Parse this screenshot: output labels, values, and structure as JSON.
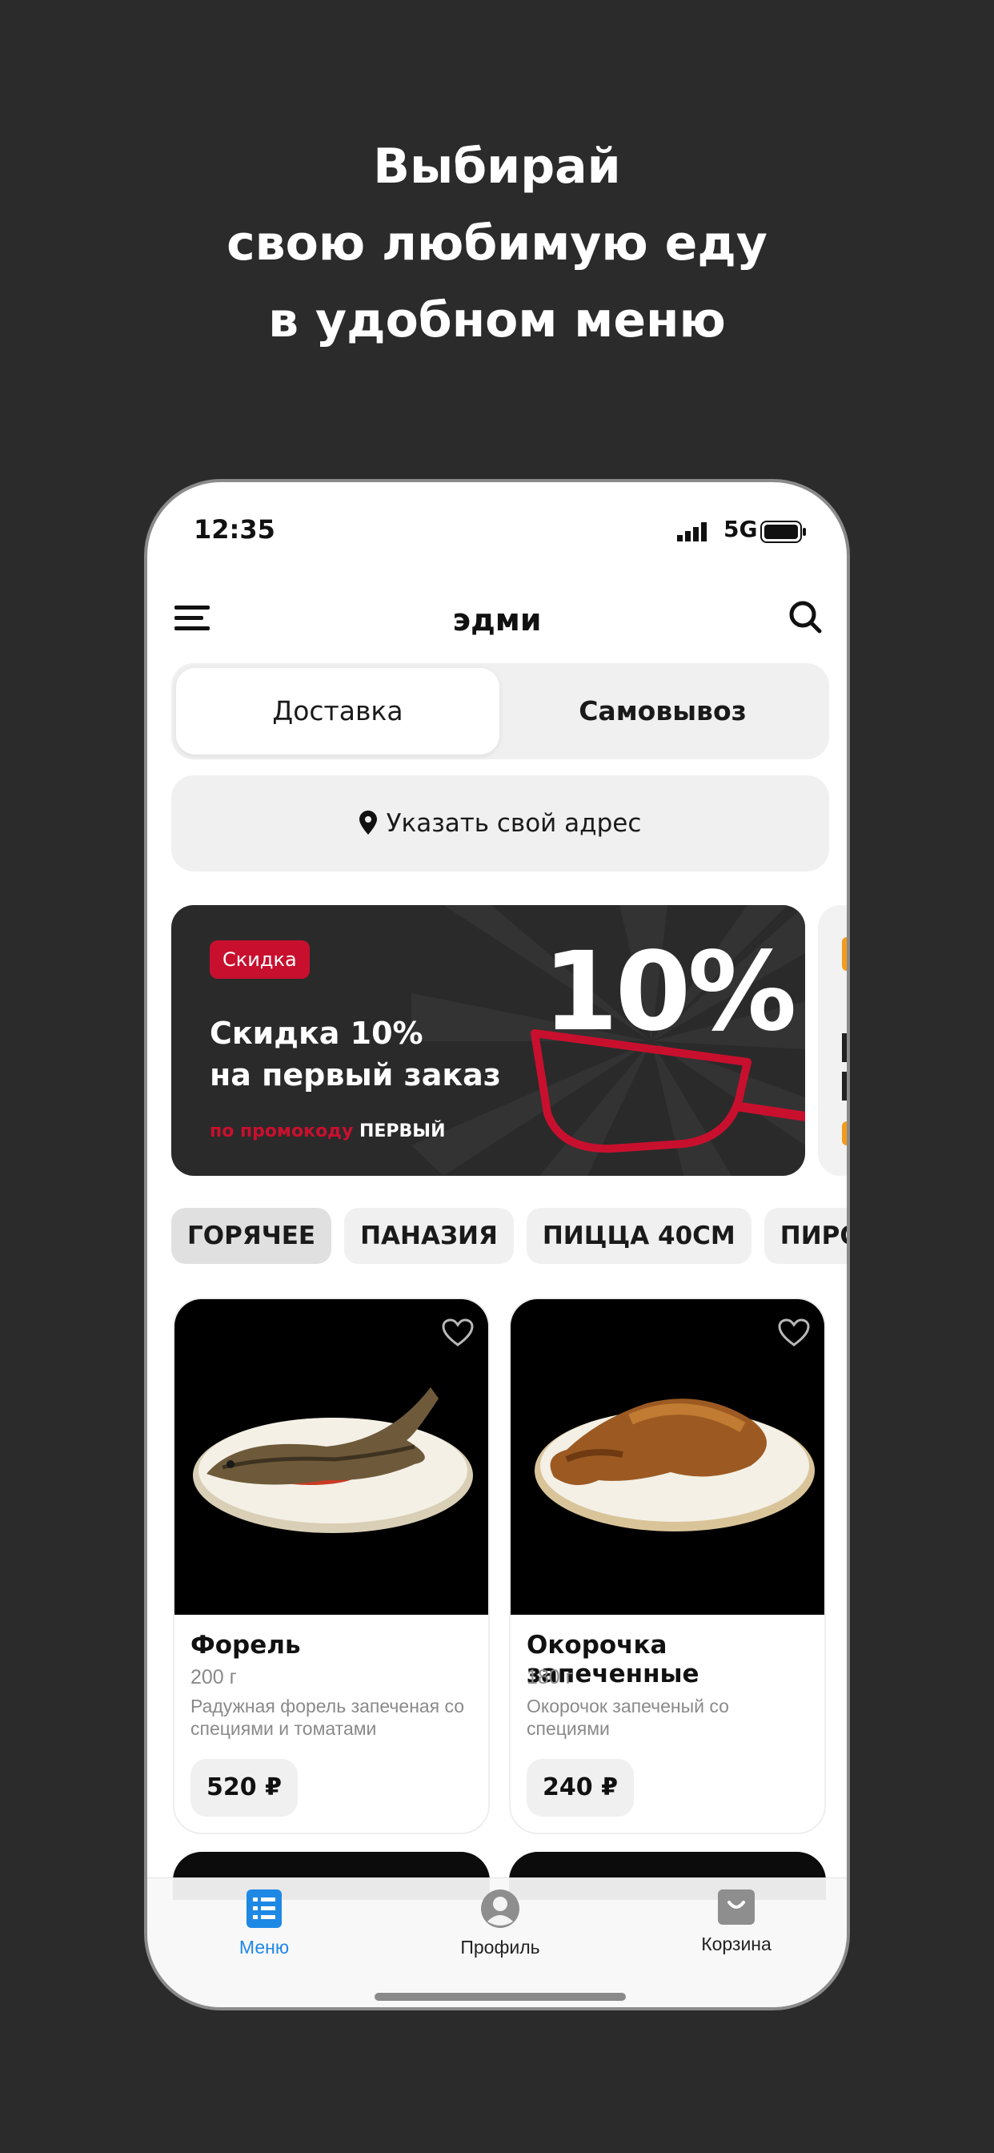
{
  "headline": [
    "Выбирай",
    "свою любимую еду",
    "в удобном меню"
  ],
  "status": {
    "time": "12:35",
    "network": "5G"
  },
  "app": {
    "brand": "эдми"
  },
  "delivery_toggle": {
    "options": [
      "Доставка",
      "Самовывоз"
    ],
    "selected": "Доставка"
  },
  "address": {
    "label": "Указать свой адрес"
  },
  "promo_banner": {
    "tag": "Скидка",
    "title_line1": "Скидка 10%",
    "title_line2": "на первый заказ",
    "promo_prefix": "по промокоду",
    "promo_code": "ПЕРВЫЙ",
    "big_text": "10%",
    "colors": {
      "background": "#2a2a2a",
      "accent": "#c8102e"
    }
  },
  "categories": [
    "ГОРЯЧЕЕ",
    "ПАНАЗИЯ",
    "ПИЦЦА 40СМ",
    "ПИРО"
  ],
  "products": [
    {
      "name": "Форель",
      "weight": "200 г",
      "description": "Радужная форель запеченая со специями и томатами",
      "price": "520 ₽",
      "icon": "heart-icon"
    },
    {
      "name": "Окорочка запеченные",
      "weight": "180 г",
      "description": "Окорочок запеченый со специями",
      "price": "240 ₽",
      "icon": "heart-icon"
    }
  ],
  "tabbar": [
    {
      "label": "Меню",
      "icon": "menu-list-icon",
      "active": true
    },
    {
      "label": "Профиль",
      "icon": "profile-icon",
      "active": false
    },
    {
      "label": "Корзина",
      "icon": "cart-icon",
      "active": false
    }
  ],
  "colors": {
    "page_bg": "#2b2b2b",
    "active_tab": "#1e88e5"
  }
}
